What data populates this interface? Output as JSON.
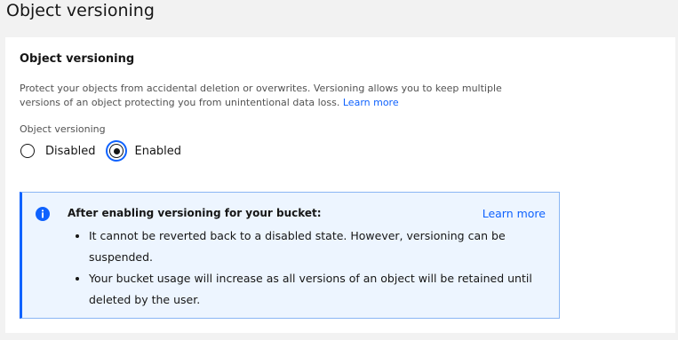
{
  "page": {
    "title": "Object versioning"
  },
  "section": {
    "title": "Object versioning",
    "description": "Protect your objects from accidental deletion or overwrites. Versioning allows you to keep multiple versions of an object protecting you from unintentional data loss.",
    "learn_more": "Learn more",
    "field_label": "Object versioning",
    "options": [
      {
        "label": "Disabled",
        "checked": false
      },
      {
        "label": "Enabled",
        "checked": true
      }
    ]
  },
  "notification": {
    "icon": "info-icon",
    "title": "After enabling versioning for your bucket:",
    "learn_more": "Learn more",
    "items": [
      "It cannot be reverted back to a disabled state. However, versioning can be suspended.",
      "Your bucket usage will increase as all versions of an object will be retained until deleted by the user."
    ]
  },
  "colors": {
    "accent": "#0f62fe",
    "notification_bg": "#edf5ff",
    "page_bg": "#f2f2f2"
  }
}
